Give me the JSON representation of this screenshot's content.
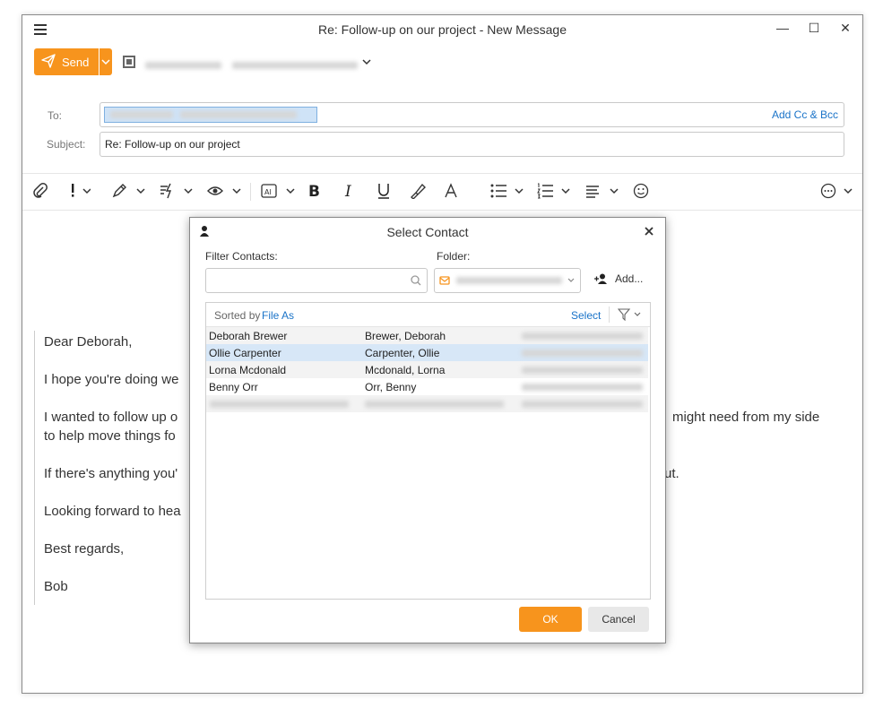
{
  "window": {
    "title": "Re: Follow-up on our project - New Message",
    "controls": {
      "minimize": "—",
      "maximize": "☐",
      "close": "✕"
    }
  },
  "compose": {
    "send_label": "Send",
    "to_label": "To:",
    "subject_label": "Subject:",
    "subject_value": "Re: Follow-up on our project",
    "add_cc_bcc": "Add Cc & Bcc"
  },
  "toolbar": {
    "icons": [
      "paperclip-icon",
      "importance-icon",
      "signature-icon",
      "quick-parts-icon",
      "eye-icon",
      "ai-icon",
      "bold-icon",
      "italic-icon",
      "underline-icon",
      "format-painter-icon",
      "font-color-icon",
      "bullet-list-icon",
      "numbered-list-icon",
      "align-icon",
      "emoji-icon",
      "more-icon"
    ]
  },
  "message": {
    "paragraphs": [
      "Dear Deborah,",
      "I hope you're doing we",
      "I wanted to follow up o",
      "to help move things fo",
      "If there's anything you'",
      "Looking forward to hea",
      "Best regards,",
      "Bob"
    ],
    "right_fragments": [
      "might need from my side",
      "ut."
    ]
  },
  "dialog": {
    "title": "Select Contact",
    "filter_label": "Filter Contacts:",
    "folder_label": "Folder:",
    "add_label": "Add...",
    "sorted_by_prefix": "Sorted by",
    "sorted_by_field": "File As",
    "select_label": "Select",
    "ok_label": "OK",
    "cancel_label": "Cancel",
    "contacts": [
      {
        "name": "Deborah Brewer",
        "file_as": "Brewer, Deborah"
      },
      {
        "name": "Ollie Carpenter",
        "file_as": "Carpenter, Ollie"
      },
      {
        "name": "Lorna Mcdonald",
        "file_as": "Mcdonald, Lorna"
      },
      {
        "name": "Benny Orr",
        "file_as": "Orr, Benny"
      }
    ],
    "selected_index": 1,
    "accent_color": "#f7941d",
    "link_color": "#1a73c8",
    "selected_row_color": "#d7e7f7"
  }
}
